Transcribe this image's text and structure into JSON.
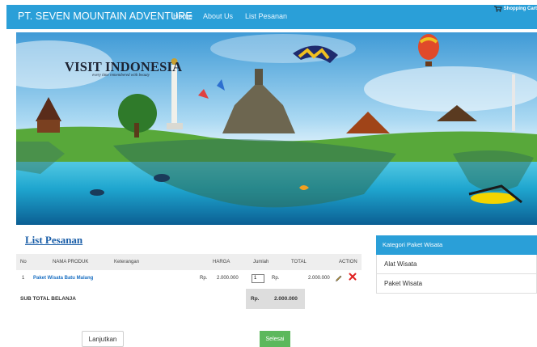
{
  "navbar": {
    "brand": "PT. SEVEN MOUNTAIN ADVENTURE",
    "links": [
      "Home",
      "About Us",
      "List Pesanan"
    ],
    "cart_label": "Shopping Cart"
  },
  "banner": {
    "title": "VISIT INDONESIA",
    "subtitle": "every time remembered with beauty"
  },
  "order": {
    "title": "List Pesanan",
    "columns": [
      "No",
      "NAMA PRODUK",
      "Keterangan",
      "HARGA",
      "Jumlah",
      "TOTAL",
      "ACTION"
    ],
    "rows": [
      {
        "no": "1",
        "product": "Paket Wisata Batu Malang",
        "keterangan": "",
        "currency": "Rp.",
        "harga": "2.000.000",
        "jumlah": "1",
        "total_currency": "Rp.",
        "total": "2.000.000"
      }
    ],
    "subtotal_label": "SUB TOTAL BELANJA",
    "subtotal_currency": "Rp.",
    "subtotal_value": "2.000.000"
  },
  "buttons": {
    "continue": "Lanjutkan",
    "finish": "Selesai"
  },
  "sidebar": {
    "header": "Kategori Paket Wisata",
    "items": [
      "Alat Wisata",
      "Paket Wisata"
    ]
  },
  "colors": {
    "primary": "#2a9fd8",
    "link": "#1a6fc2",
    "success": "#5cb85c",
    "danger": "#e02020"
  }
}
